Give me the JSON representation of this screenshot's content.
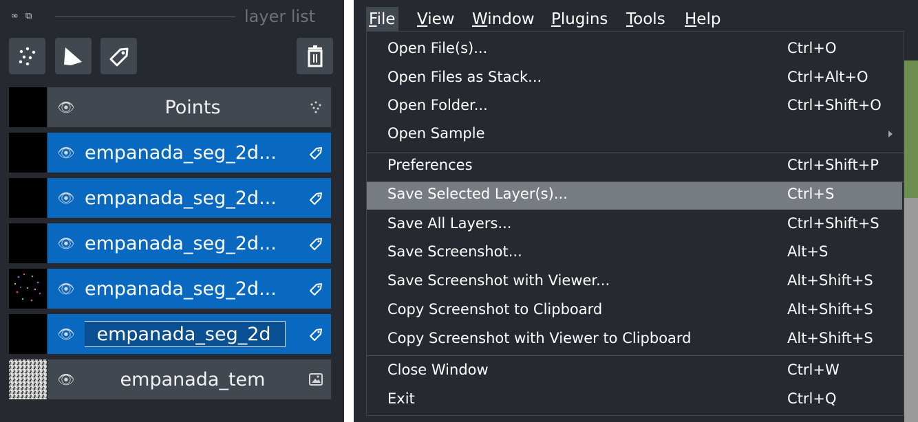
{
  "layer_panel": {
    "title": "layer list",
    "rows": [
      {
        "name": "Points",
        "selected": false,
        "type_icon": "points-icon"
      },
      {
        "name": "empanada_seg_2d...",
        "selected": true,
        "type_icon": "labels-icon"
      },
      {
        "name": "empanada_seg_2d...",
        "selected": true,
        "type_icon": "labels-icon"
      },
      {
        "name": "empanada_seg_2d...",
        "selected": true,
        "type_icon": "labels-icon"
      },
      {
        "name": "empanada_seg_2d...",
        "selected": true,
        "type_icon": "labels-icon"
      },
      {
        "name": "empanada_seg_2d",
        "selected": true,
        "editing": true,
        "type_icon": "labels-icon"
      },
      {
        "name": "empanada_tem",
        "selected": false,
        "type_icon": "image-icon"
      }
    ],
    "colors": {
      "background": "#262930",
      "selected": "#0969c0",
      "unselected": "#414850"
    }
  },
  "menubar": {
    "items": [
      {
        "mnemonic": "F",
        "rest": "ile",
        "active": true
      },
      {
        "mnemonic": "V",
        "rest": "iew",
        "active": false
      },
      {
        "mnemonic": "W",
        "rest": "indow",
        "active": false
      },
      {
        "mnemonic": "P",
        "rest": "lugins",
        "active": false
      },
      {
        "mnemonic": "T",
        "rest": "ools",
        "active": false
      },
      {
        "mnemonic": "H",
        "rest": "elp",
        "active": false
      }
    ]
  },
  "file_menu": {
    "items": [
      {
        "label": "Open File(s)...",
        "shortcut": "Ctrl+O"
      },
      {
        "label": "Open Files as Stack...",
        "shortcut": "Ctrl+Alt+O"
      },
      {
        "label": "Open Folder...",
        "shortcut": "Ctrl+Shift+O"
      },
      {
        "label": "Open Sample",
        "shortcut": "",
        "submenu": true
      },
      {
        "label": "Preferences",
        "shortcut": "Ctrl+Shift+P"
      },
      {
        "label": "Save Selected Layer(s)...",
        "shortcut": "Ctrl+S",
        "highlighted": true
      },
      {
        "label": "Save All Layers...",
        "shortcut": "Ctrl+Shift+S"
      },
      {
        "label": "Save Screenshot...",
        "shortcut": "Alt+S"
      },
      {
        "label": "Save Screenshot with Viewer...",
        "shortcut": "Alt+Shift+S"
      },
      {
        "label": "Copy Screenshot to Clipboard",
        "shortcut": "Alt+Shift+S"
      },
      {
        "label": "Copy Screenshot with Viewer to Clipboard",
        "shortcut": "Alt+Shift+S"
      },
      {
        "label": "Close Window",
        "shortcut": "Ctrl+W"
      },
      {
        "label": "Exit",
        "shortcut": "Ctrl+Q"
      }
    ],
    "colors": {
      "highlight": "#777c83"
    }
  }
}
